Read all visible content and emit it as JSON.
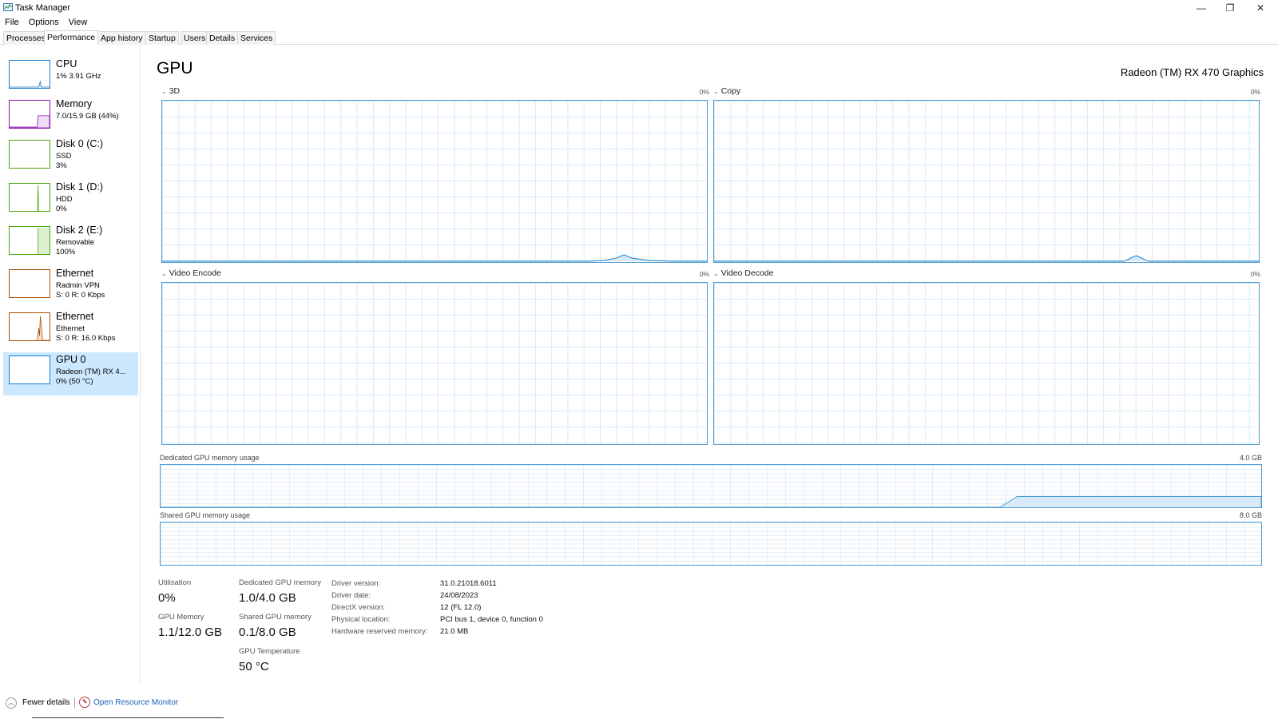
{
  "window": {
    "title": "Task Manager",
    "minimize": "—",
    "maximize": "❐",
    "close": "✕"
  },
  "menu": [
    "File",
    "Options",
    "View"
  ],
  "tabs": [
    "Processes",
    "Performance",
    "App history",
    "Startup",
    "Users",
    "Details",
    "Services"
  ],
  "active_tab": "Performance",
  "sidebar": [
    {
      "title": "CPU",
      "sub1": "1% 3.91 GHz",
      "sub2": "",
      "color": "#1979ca"
    },
    {
      "title": "Memory",
      "sub1": "7.0/15.9 GB (44%)",
      "sub2": "",
      "color": "#8b12ae"
    },
    {
      "title": "Disk 0 (C:)",
      "sub1": "SSD",
      "sub2": "3%",
      "color": "#4da60c"
    },
    {
      "title": "Disk 1 (D:)",
      "sub1": "HDD",
      "sub2": "0%",
      "color": "#4da60c"
    },
    {
      "title": "Disk 2 (E:)",
      "sub1": "Removable",
      "sub2": "100%",
      "color": "#4da60c"
    },
    {
      "title": "Ethernet",
      "sub1": "Radmin VPN",
      "sub2": "S: 0 R: 0 Kbps",
      "color": "#a74f01"
    },
    {
      "title": "Ethernet",
      "sub1": "Ethernet",
      "sub2": "S: 0 R: 16.0 Kbps",
      "color": "#a74f01"
    },
    {
      "title": "GPU 0",
      "sub1": "Radeon (TM) RX 4...",
      "sub2": "0% (50 °C)",
      "color": "#1979ca"
    }
  ],
  "main": {
    "title": "GPU",
    "device_name": "Radeon (TM) RX 470 Graphics",
    "graphs": [
      {
        "label": "3D",
        "pct": "0%"
      },
      {
        "label": "Copy",
        "pct": "0%"
      },
      {
        "label": "Video Encode",
        "pct": "0%"
      },
      {
        "label": "Video Decode",
        "pct": "0%"
      }
    ],
    "dedicated_mem": {
      "label": "Dedicated GPU memory usage",
      "max": "4.0 GB"
    },
    "shared_mem": {
      "label": "Shared GPU memory usage",
      "max": "8.0 GB"
    }
  },
  "stats": {
    "utilisation_label": "Utilisation",
    "utilisation_value": "0%",
    "dedicated_label": "Dedicated GPU memory",
    "dedicated_value": "1.0/4.0 GB",
    "gpu_memory_label": "GPU Memory",
    "gpu_memory_value": "1.1/12.0 GB",
    "shared_label": "Shared GPU memory",
    "shared_value": "0.1/8.0 GB",
    "temp_label": "GPU Temperature",
    "temp_value": "50 °C"
  },
  "info": [
    {
      "key": "Driver version:",
      "value": "31.0.21018.6011"
    },
    {
      "key": "Driver date:",
      "value": "24/08/2023"
    },
    {
      "key": "DirectX version:",
      "value": "12 (FL 12.0)"
    },
    {
      "key": "Physical location:",
      "value": "PCI bus 1, device 0, function 0"
    },
    {
      "key": "Hardware reserved memory:",
      "value": "21.0 MB"
    }
  ],
  "footer": {
    "fewer_details": "Fewer details",
    "open_resource_monitor": "Open Resource Monitor"
  }
}
